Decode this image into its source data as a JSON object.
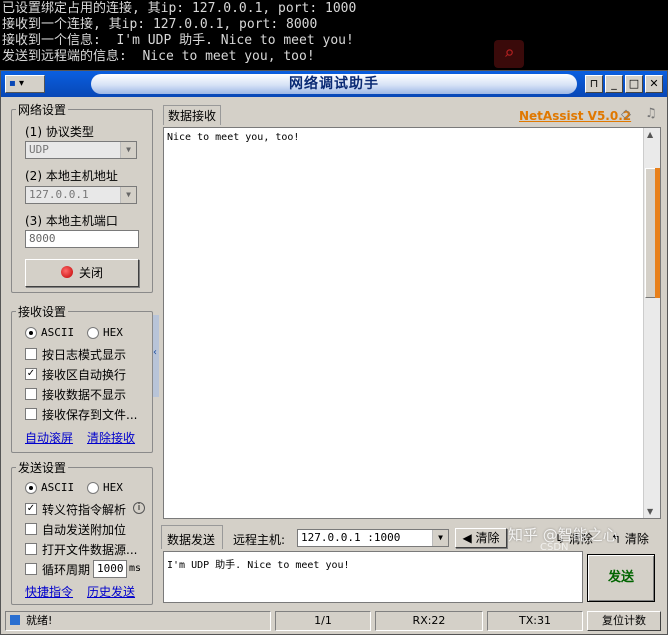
{
  "console": {
    "lines": [
      "已设置绑定占用的连接, 其ip: 127.0.0.1, port: 1000",
      "接收到一个连接, 其ip: 127.0.0.1, port: 8000",
      "接收到一个信息:  I'm UDP 助手. Nice to meet you!",
      "发送到远程端的信息:  Nice to meet you, too!"
    ]
  },
  "window": {
    "title": "网络调试助手",
    "sysmenu_label": "▾",
    "buttons": {
      "pin": "⊓",
      "min": "_",
      "max": "□",
      "close": "✕"
    }
  },
  "net_settings": {
    "legend": "网络设置",
    "protocol_label": "(1) 协议类型",
    "protocol_value": "UDP",
    "host_label": "(2) 本地主机地址",
    "host_value": "127.0.0.1",
    "port_label": "(3) 本地主机端口",
    "port_value": "8000",
    "close_button": "关闭"
  },
  "recv_settings": {
    "legend": "接收设置",
    "ascii": "ASCII",
    "hex": "HEX",
    "options": [
      {
        "label": "按日志模式显示",
        "checked": false
      },
      {
        "label": "接收区自动换行",
        "checked": true
      },
      {
        "label": "接收数据不显示",
        "checked": false
      },
      {
        "label": "接收保存到文件...",
        "checked": false
      }
    ],
    "link_auto_scroll": "自动滚屏",
    "link_clear": "清除接收"
  },
  "send_settings": {
    "legend": "发送设置",
    "ascii": "ASCII",
    "hex": "HEX",
    "opt_escape": "转义符指令解析",
    "opt_auto_add": "自动发送附加位",
    "opt_open_file": "打开文件数据源...",
    "opt_cycle": "循环周期",
    "cycle_value": "1000",
    "cycle_unit": "ms",
    "link_shortcut": "快捷指令",
    "link_history": "历史发送"
  },
  "receive": {
    "tab_label": "数据接收",
    "brand": "NetAssist V5.0.2",
    "content": "Nice to meet you, too!"
  },
  "send": {
    "tab_label": "数据发送",
    "remote_label": "远程主机:",
    "remote_value": "127.0.0.1 :1000",
    "clear_label": "清除",
    "clear2_label": "清除",
    "clear3_label": "清除",
    "content": "I'm UDP 助手. Nice to meet you!",
    "send_button": "发送"
  },
  "status": {
    "ready": "就绪!",
    "page": "1/1",
    "rx": "RX:22",
    "tx": "TX:31",
    "reset": "复位计数"
  },
  "watermark": {
    "text": "知乎 @智能之心",
    "csdn": "CSDN"
  }
}
